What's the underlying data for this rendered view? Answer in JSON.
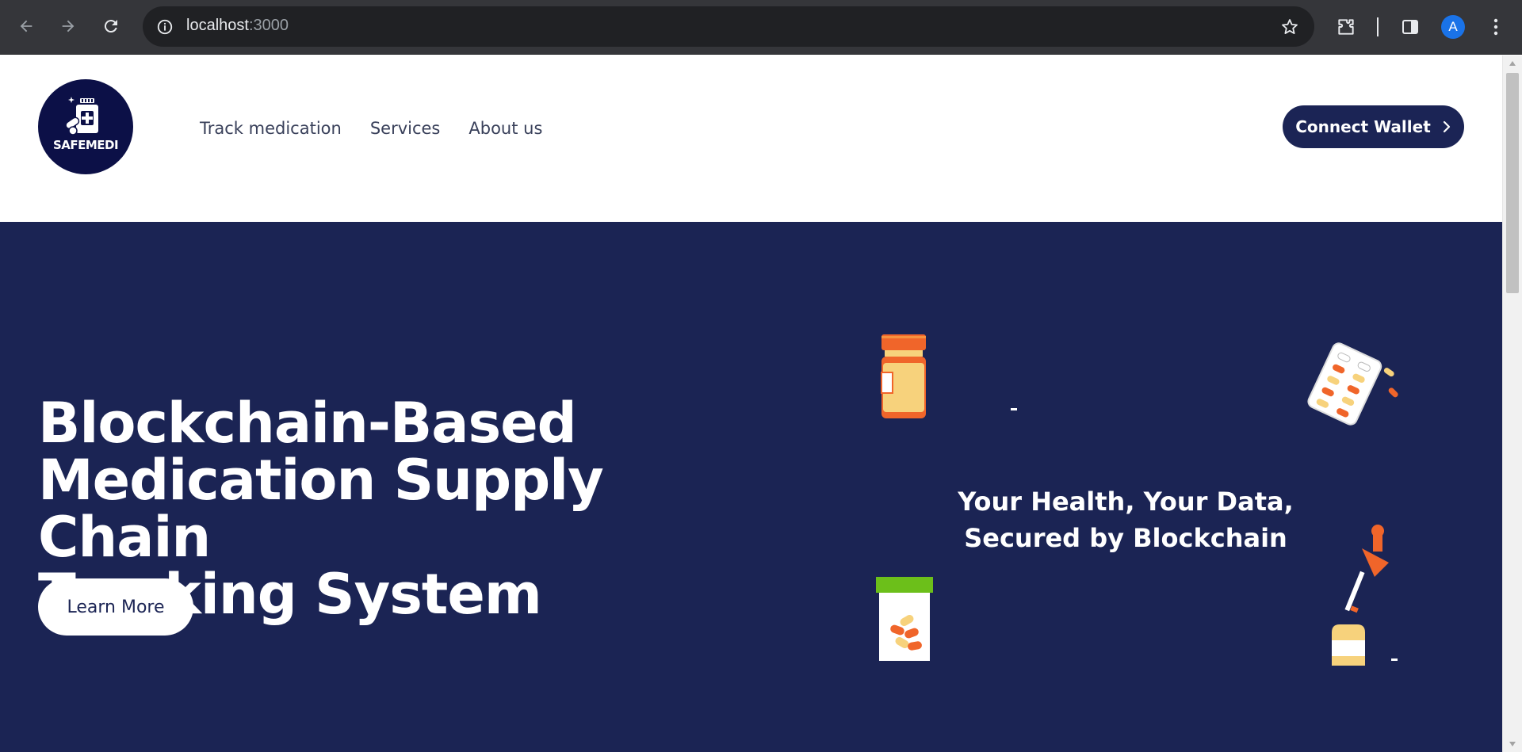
{
  "browser": {
    "url_host": "localhost",
    "url_port": ":3000",
    "profile_initial": "A",
    "icons": {
      "back": "arrow-left-icon",
      "forward": "arrow-right-icon",
      "reload": "reload-icon",
      "site_info": "info-icon",
      "bookmark": "star-icon",
      "extensions": "puzzle-icon",
      "side_panel": "side-panel-icon",
      "menu": "kebab-menu-icon"
    }
  },
  "site": {
    "logo_text": "SAFEMEDI",
    "nav": [
      {
        "label": "Track medication"
      },
      {
        "label": "Services"
      },
      {
        "label": "About us"
      }
    ],
    "connect_label": "Connect Wallet",
    "headline_line1": "Blockchain-Based",
    "headline_line2": "Medication Supply Chain",
    "headline_line3": "Tracking System",
    "learn_more_label": "Learn More",
    "tagline_line1": "Your Health, Your Data,",
    "tagline_line2": "Secured by Blockchain"
  },
  "colors": {
    "hero_bg": "#1b2454",
    "logo_bg": "#0c1047",
    "button_dark": "#1b2455",
    "pill_orange": "#f0652a",
    "pill_yellow": "#f7d27c",
    "cap_green": "#6cbf1a"
  }
}
